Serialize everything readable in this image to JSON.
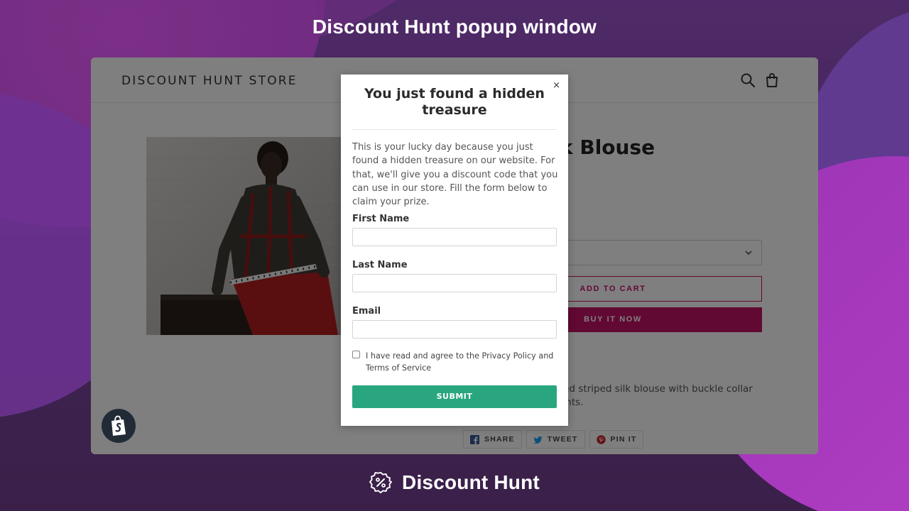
{
  "banner": {
    "title": "Discount Hunt popup window"
  },
  "store": {
    "name": "DISCOUNT HUNT STORE",
    "product_title_visible": "k Blouse",
    "add_to_cart": "ADD TO CART",
    "buy_now": "BUY IT NOW",
    "description_line1": "red striped silk blouse with buckle collar",
    "description_line2": "ants.",
    "share": {
      "facebook": "SHARE",
      "twitter": "TWEET",
      "pinterest": "PIN IT"
    }
  },
  "popup": {
    "close": "×",
    "title": "You just found a hidden treasure",
    "text": "This is your lucky day because you just found a hidden treasure on our website. For that, we'll give you a discount code that you can use in our store. Fill the form below to claim your prize.",
    "first_name_label": "First Name",
    "first_name_value": "",
    "last_name_label": "Last Name",
    "last_name_value": "",
    "email_label": "Email",
    "email_value": "",
    "agree_text": "I have read and agree to the Privacy Policy and Terms of Service",
    "submit": "SUBMIT"
  },
  "brand": {
    "name": "Discount Hunt"
  },
  "colors": {
    "accent_pink": "#c41266",
    "submit_green": "#29a680",
    "background_purple": "#4a2a63"
  },
  "icons": [
    "search-icon",
    "cart-icon",
    "chevron-down-icon",
    "close-icon",
    "facebook-icon",
    "twitter-icon",
    "pinterest-icon",
    "shopify-icon",
    "discount-badge-icon"
  ]
}
